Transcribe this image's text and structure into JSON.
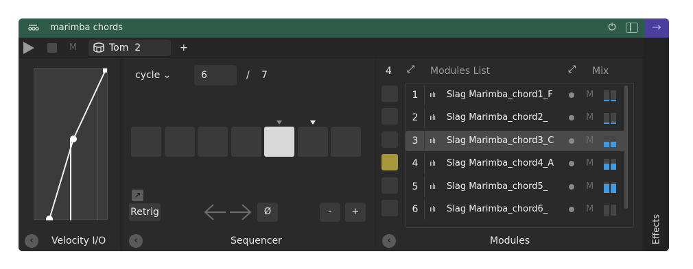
{
  "titlebar": {
    "title": "marimba chords",
    "device_icon": "chain-icon",
    "power_icon": "⏻"
  },
  "transport": {
    "mute_label": "M",
    "selector_name": "Tom",
    "selector_number": "2",
    "add_label": "+"
  },
  "velocity": {
    "footer_title": "Velocity I/O",
    "back_glyph": "‹"
  },
  "sequencer": {
    "mode": "cycle",
    "mode_chevron": "⌄",
    "current_step": "6",
    "slash": "/",
    "total_steps": "7",
    "steps": [
      {
        "state": "off",
        "marker": false
      },
      {
        "state": "off",
        "marker": false
      },
      {
        "state": "off",
        "marker": false
      },
      {
        "state": "off",
        "marker": false
      },
      {
        "state": "on",
        "marker": "gray"
      },
      {
        "state": "off",
        "marker": "white"
      },
      {
        "state": "off",
        "marker": false
      }
    ],
    "retrig_label": "Retrig",
    "arrows_glyph": "←→",
    "zero_label": "Ø",
    "minus_label": "-",
    "plus_label": "+",
    "footer_title": "Sequencer",
    "back_glyph": "‹"
  },
  "modules": {
    "count": "4",
    "list_title": "Modules List",
    "mix_title": "Mix",
    "footer_title": "Modules",
    "back_glyph": "‹",
    "wave_glyph": "ıılı",
    "rows": [
      {
        "index": "1",
        "name": "Slag Marimba_chord1_F",
        "mute": "M",
        "mix": [
          0.1,
          0.1
        ],
        "selected": false,
        "left_on": false
      },
      {
        "index": "2",
        "name": "Slag Marimba_chord2_",
        "mute": "M",
        "mix": [
          0.1,
          0.1
        ],
        "selected": false,
        "left_on": false
      },
      {
        "index": "3",
        "name": "Slag Marimba_chord3_C",
        "mute": "M",
        "mix": [
          0.5,
          0.5
        ],
        "selected": true,
        "left_on": false
      },
      {
        "index": "4",
        "name": "Slag Marimba_chord4_A",
        "mute": "M",
        "mix": [
          0.55,
          0.55
        ],
        "selected": false,
        "left_on": true
      },
      {
        "index": "5",
        "name": "Slag Marimba_chord5_",
        "mute": "M",
        "mix": [
          0.8,
          0.8
        ],
        "selected": false,
        "left_on": false
      },
      {
        "index": "6",
        "name": "Slag Marimba_chord6_",
        "mute": "M",
        "mix": [
          0,
          0
        ],
        "selected": false,
        "left_on": false
      }
    ]
  },
  "effects": {
    "label": "Effects"
  },
  "colors": {
    "titlebar": "#2f5b4b",
    "accent_purple": "#4b3f9e",
    "meter_blue": "#3b9be6",
    "module_active": "#a8963d"
  }
}
